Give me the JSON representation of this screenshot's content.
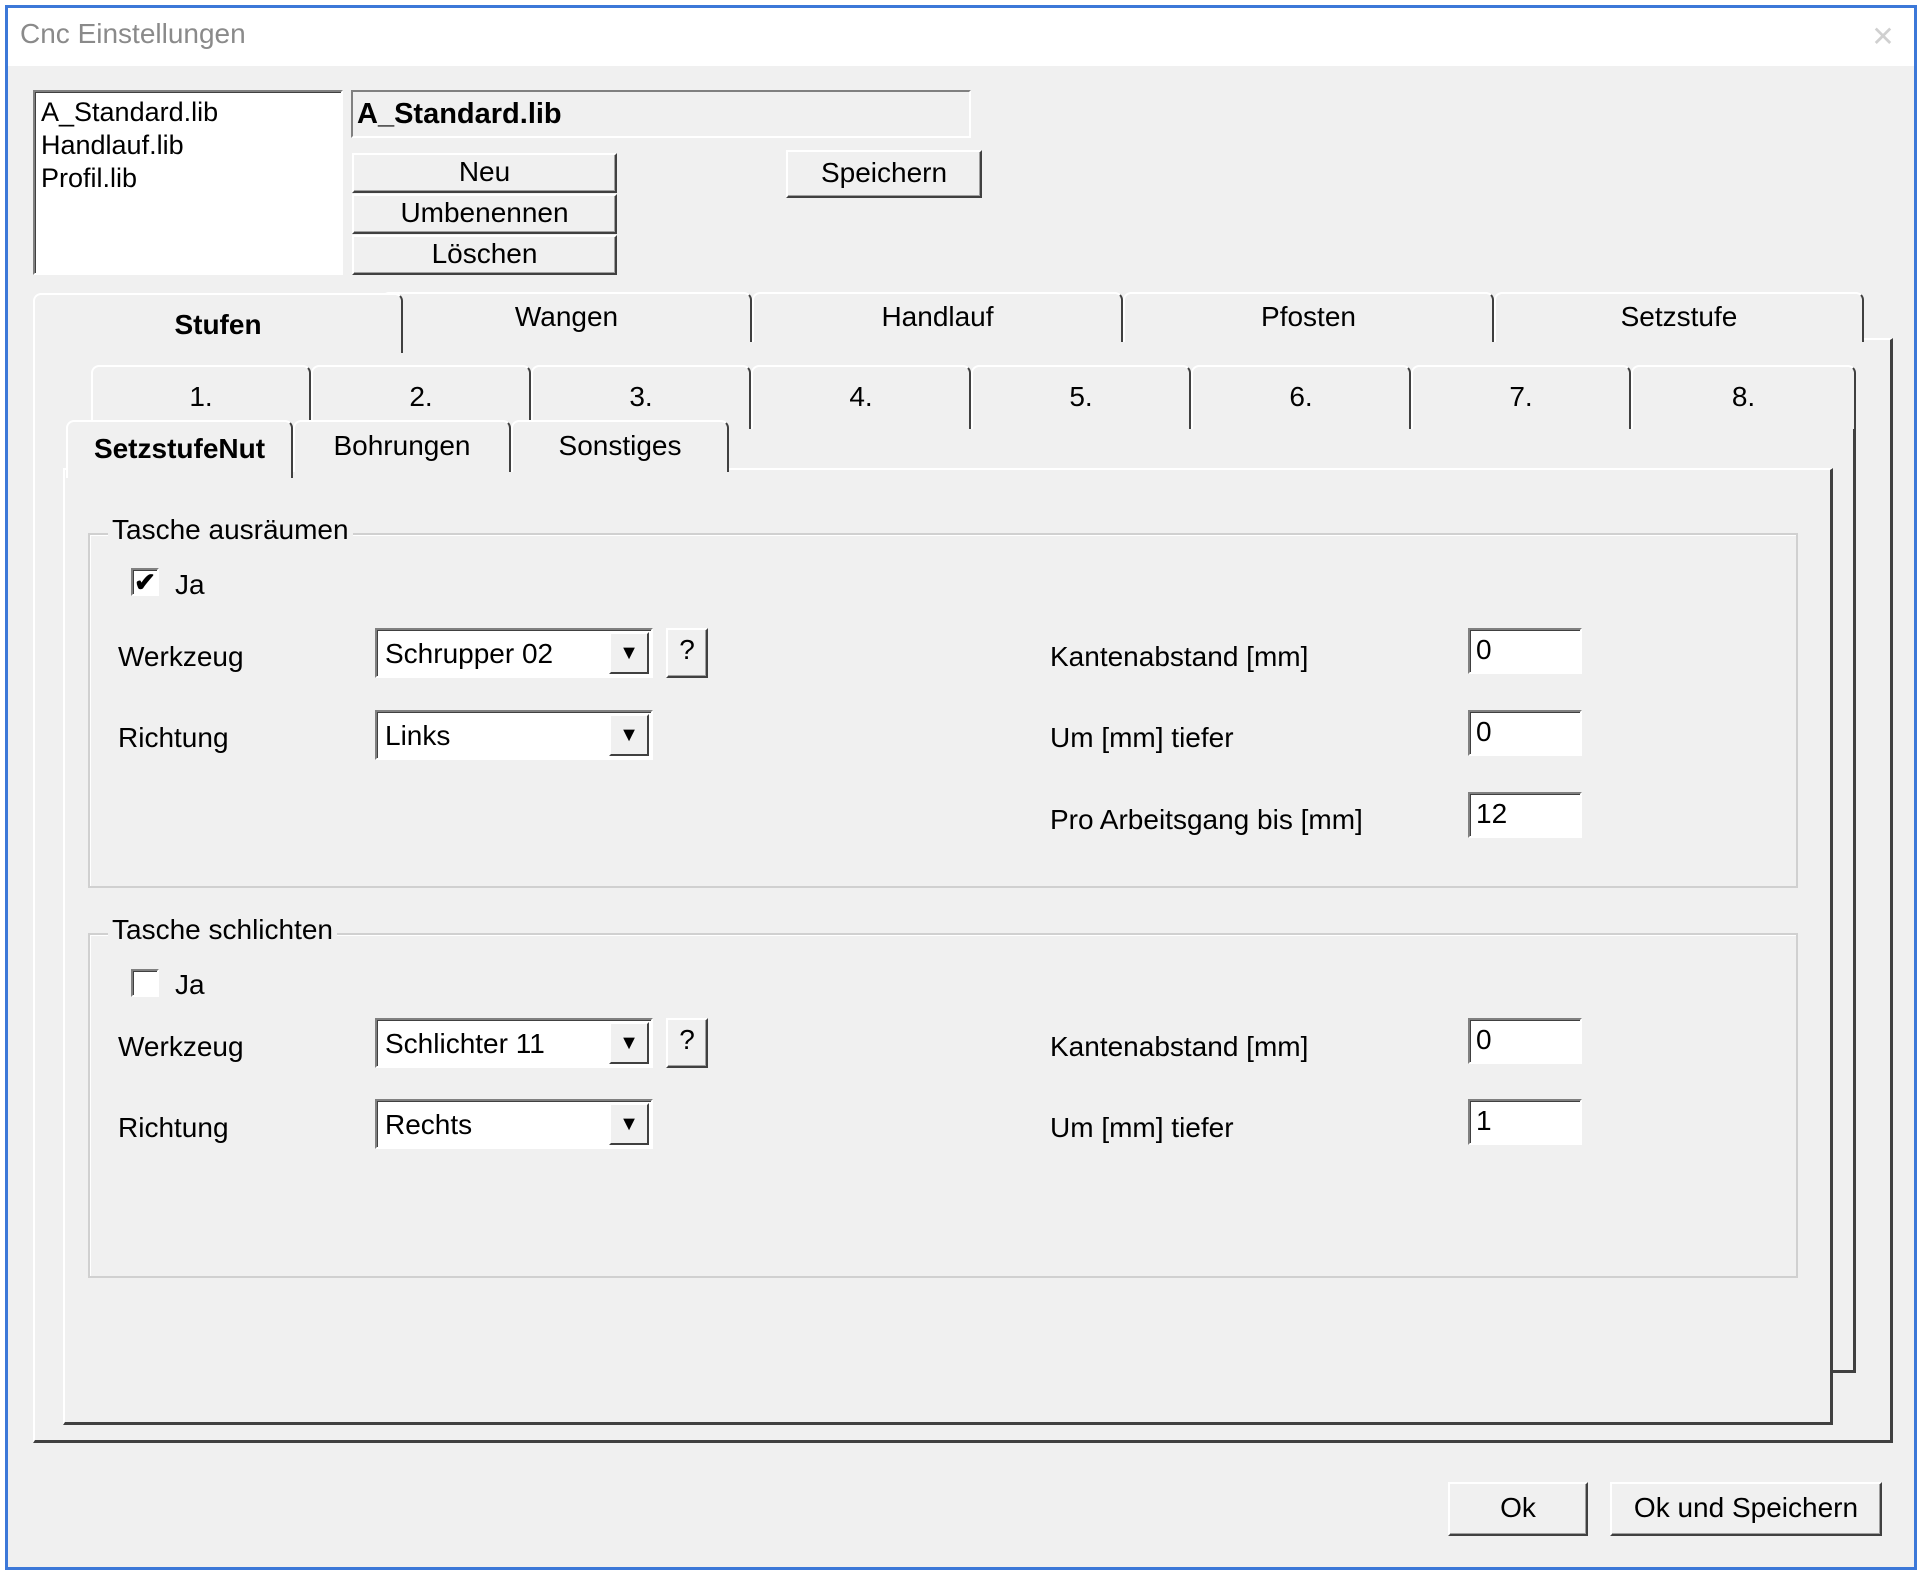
{
  "window": {
    "title": "Cnc Einstellungen",
    "close_glyph": "✕"
  },
  "libraries": {
    "items": [
      "A_Standard.lib",
      "Handlauf.lib",
      "Profil.lib"
    ],
    "selected_name": "A_Standard.lib",
    "buttons": {
      "new": "Neu",
      "rename": "Umbenennen",
      "delete": "Löschen",
      "save": "Speichern"
    }
  },
  "main_tabs": [
    "Stufen",
    "Wangen",
    "Handlauf",
    "Pfosten",
    "Setzstufe"
  ],
  "main_tab_active": "Stufen",
  "number_tabs": [
    "1.",
    "2.",
    "3.",
    "4.",
    "5.",
    "6.",
    "7.",
    "8."
  ],
  "sub_tabs": [
    "SetzstufeNut",
    "Bohrungen",
    "Sonstiges"
  ],
  "sub_tab_active": "SetzstufeNut",
  "group1": {
    "title": "Tasche ausräumen",
    "checkbox_label": "Ja",
    "checked": true,
    "check_glyph": "✔",
    "werkzeug_label": "Werkzeug",
    "werkzeug_value": "Schrupper 02",
    "richtung_label": "Richtung",
    "richtung_value": "Links",
    "help_label": "?",
    "kantenabstand_label": "Kantenabstand [mm]",
    "kantenabstand_value": "0",
    "tiefer_label": "Um [mm] tiefer",
    "tiefer_value": "0",
    "arbeitsgang_label": "Pro Arbeitsgang bis [mm]",
    "arbeitsgang_value": "12"
  },
  "group2": {
    "title": "Tasche schlichten",
    "checkbox_label": "Ja",
    "checked": false,
    "werkzeug_label": "Werkzeug",
    "werkzeug_value": "Schlichter 11",
    "richtung_label": "Richtung",
    "richtung_value": "Rechts",
    "help_label": "?",
    "kantenabstand_label": "Kantenabstand [mm]",
    "kantenabstand_value": "0",
    "tiefer_label": "Um [mm] tiefer",
    "tiefer_value": "1"
  },
  "combo_arrow_glyph": "▼",
  "footer": {
    "ok": "Ok",
    "ok_save": "Ok und Speichern"
  },
  "colors": {
    "window_border": "#3c78d8",
    "face": "#f0f0f0"
  }
}
